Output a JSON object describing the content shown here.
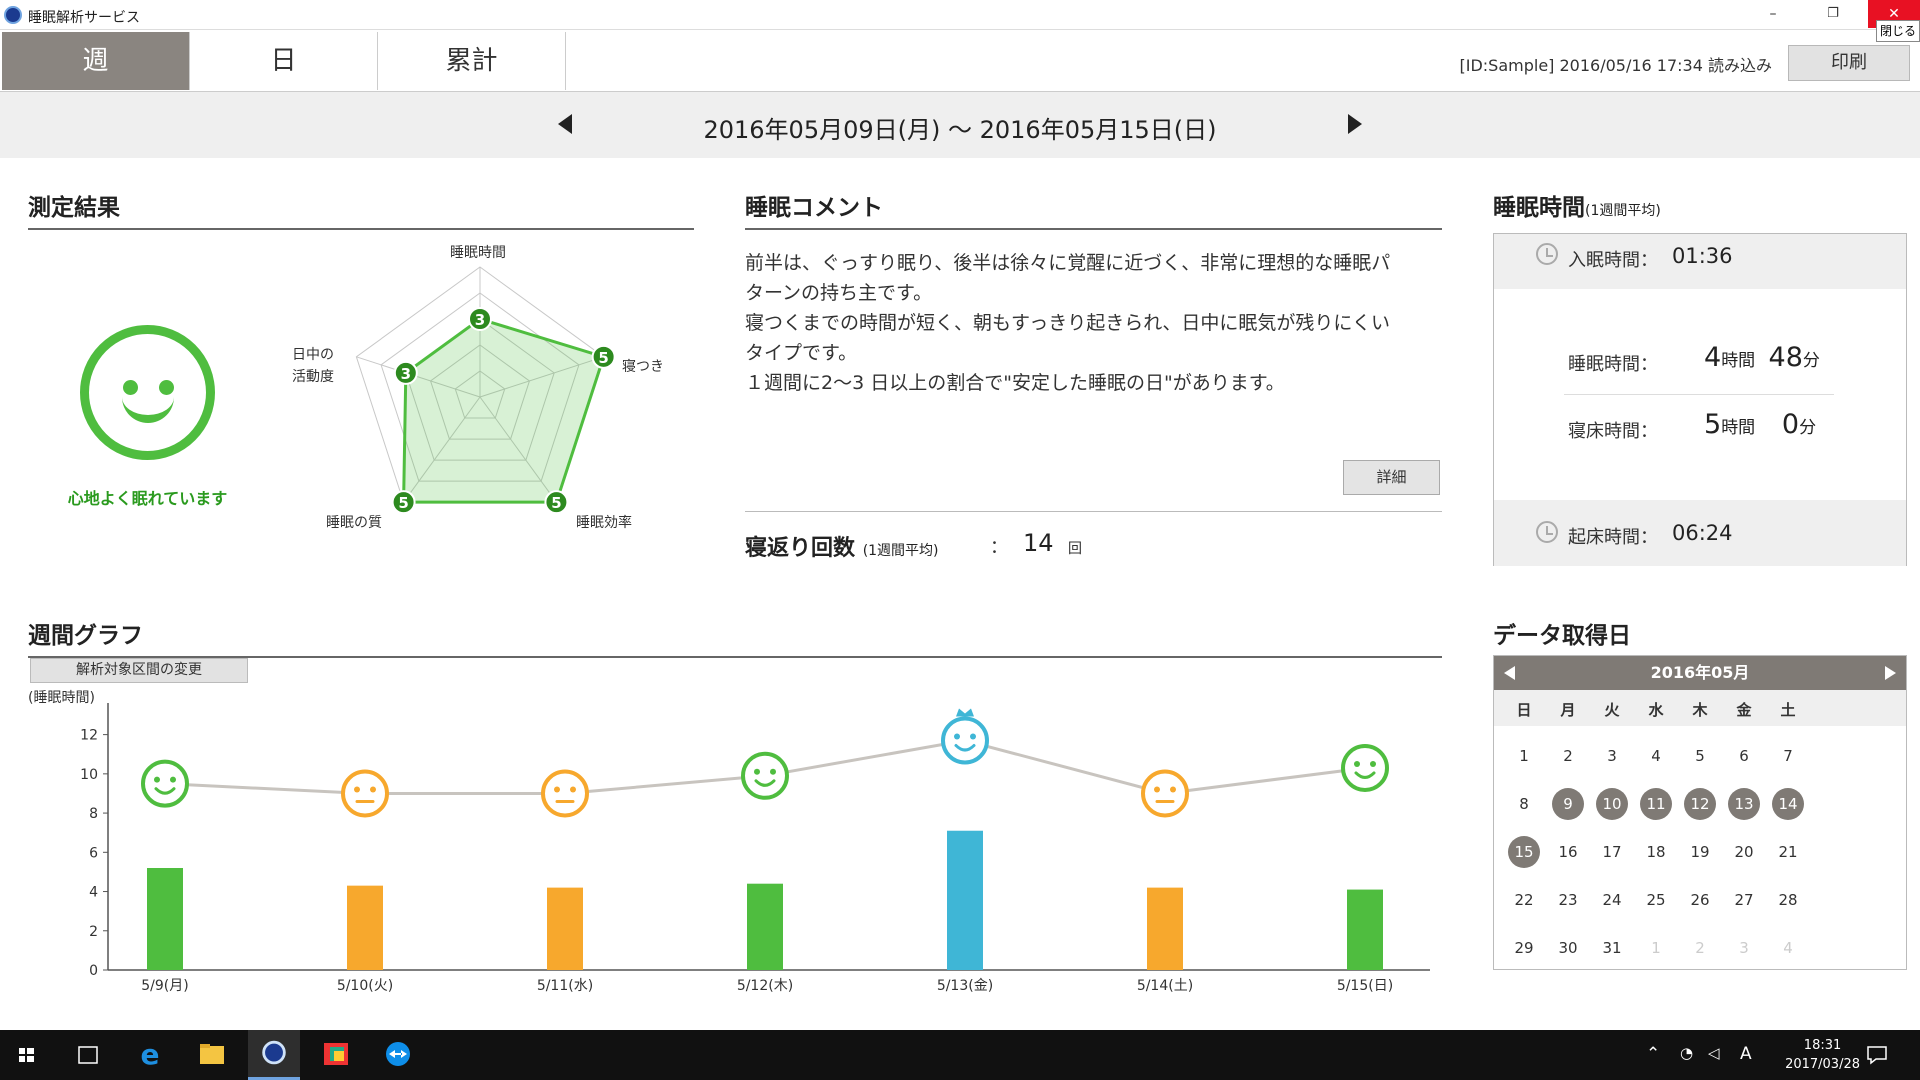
{
  "window": {
    "title": "睡眠解析サービス",
    "minimize": "–",
    "restore": "❐",
    "close": "✕",
    "close_tooltip": "閉じる"
  },
  "tabs": [
    {
      "label": "週",
      "active": true
    },
    {
      "label": "日",
      "active": false
    },
    {
      "label": "累計",
      "active": false
    }
  ],
  "header": {
    "id_info": "[ID:Sample]  2016/05/16 17:34 読み込み",
    "print_label": "印刷"
  },
  "range": {
    "text": "2016年05月09日(月) 〜 2016年05月15日(日)"
  },
  "result": {
    "heading": "測定結果",
    "status_text": "心地よく眠れています",
    "radar": {
      "axes": [
        "睡眠時間",
        "寝つき",
        "睡眠効率",
        "睡眠の質",
        "日中の活動度"
      ],
      "values": [
        3,
        5,
        5,
        5,
        3
      ],
      "max": 5,
      "labels": {
        "a0": "睡眠時間",
        "a1": "寝つき",
        "a2": "睡眠効率",
        "a3": "睡眠の質",
        "a4_line1": "日中の",
        "a4_line2": "活動度"
      }
    }
  },
  "comment": {
    "heading": "睡眠コメント",
    "lines": [
      "前半は、ぐっすり眠り、後半は徐々に覚醒に近づく、非常に理想的な睡眠パ",
      "ターンの持ち主です。",
      "寝つくまでの時間が短く、朝もすっきり起きられ、日中に眠気が残りにくい",
      "タイプです。",
      "１週間に2〜3 日以上の割合で\"安定した睡眠の日\"があります。"
    ],
    "detail_label": "詳細",
    "turn_label": "寝返り回数",
    "turn_sub": "(1週間平均)",
    "turn_colon": "：",
    "turn_value": "14",
    "turn_unit": "回"
  },
  "sleep_time": {
    "heading": "睡眠時間",
    "heading_sub": "(1週間平均)",
    "bed_in_label": "入眠時間：",
    "bed_in_value": "01:36",
    "sleep_label": "睡眠時間：",
    "sleep_hours": "4",
    "sleep_hours_unit": "時間",
    "sleep_minutes": "48",
    "sleep_minutes_unit": "分",
    "inbed_label": "寝床時間：",
    "inbed_hours": "5",
    "inbed_hours_unit": "時間",
    "inbed_minutes": "0",
    "inbed_minutes_unit": "分",
    "wake_label": "起床時間：",
    "wake_value": "06:24"
  },
  "weekly": {
    "heading": "週間グラフ",
    "change_label": "解析対象区間の変更"
  },
  "chart_data": {
    "type": "bar",
    "ylabel": "(睡眠時間)",
    "ylim": [
      0,
      13
    ],
    "yticks": [
      0,
      2,
      4,
      6,
      8,
      10,
      12
    ],
    "categories": [
      "5/9(月)",
      "5/10(火)",
      "5/11(水)",
      "5/12(木)",
      "5/13(金)",
      "5/14(土)",
      "5/15(日)"
    ],
    "values": [
      5.2,
      4.3,
      4.2,
      4.4,
      7.1,
      4.2,
      4.1
    ],
    "bar_colors": [
      "#4fbd3f",
      "#f7a82d",
      "#f7a82d",
      "#4fbd3f",
      "#3fb6d6",
      "#f7a82d",
      "#4fbd3f"
    ],
    "line_values": [
      9.5,
      9.0,
      9.0,
      9.9,
      11.7,
      9.0,
      10.3
    ],
    "moods": [
      "good",
      "normal",
      "normal",
      "good",
      "best",
      "normal",
      "good"
    ],
    "grid": false
  },
  "calendar": {
    "heading": "データ取得日",
    "month_label": "2016年05月",
    "dow": [
      "日",
      "月",
      "火",
      "水",
      "木",
      "金",
      "土"
    ],
    "weeks": [
      [
        1,
        2,
        3,
        4,
        5,
        6,
        7
      ],
      [
        8,
        9,
        10,
        11,
        12,
        13,
        14
      ],
      [
        15,
        16,
        17,
        18,
        19,
        20,
        21
      ],
      [
        22,
        23,
        24,
        25,
        26,
        27,
        28
      ],
      [
        29,
        30,
        31,
        1,
        2,
        3,
        4
      ]
    ],
    "selected": [
      9,
      10,
      11,
      12,
      13,
      14,
      15
    ],
    "other_month_from_index": 31
  },
  "taskbar": {
    "time": "18:31",
    "date": "2017/03/28",
    "ime": "A"
  },
  "colors": {
    "good": "#4fbd3f",
    "normal": "#f7a82d",
    "best": "#3fb6d6",
    "accent_gray": "#7f7a75"
  }
}
